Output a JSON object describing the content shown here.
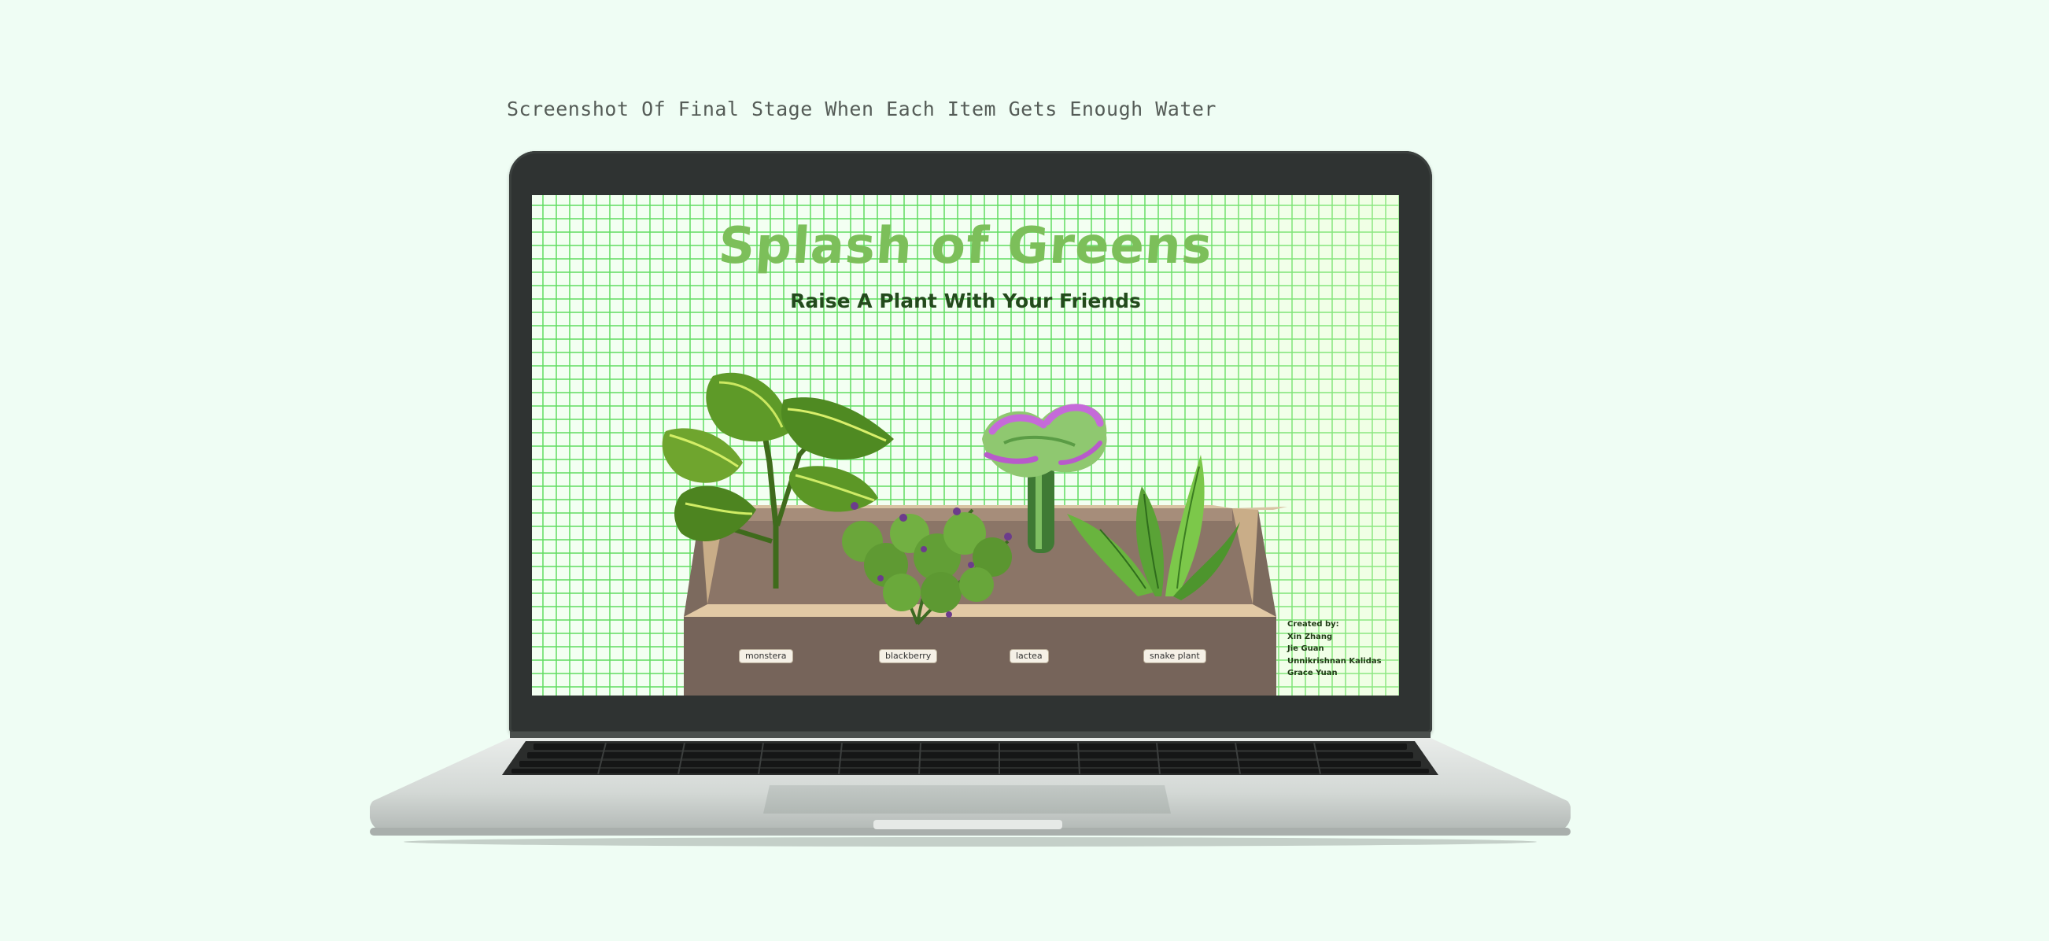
{
  "caption": "Screenshot Of Final Stage When Each Item Gets Enough Water",
  "app": {
    "title": "Splash of Greens",
    "subtitle": "Raise A Plant With Your Friends",
    "plant_tags": [
      "monstera",
      "blackberry",
      "lactea",
      "snake plant"
    ],
    "credits": {
      "heading": "Created by:",
      "names": [
        "Xin Zhang",
        "Jie Guan",
        "Unnikrishnan Kalidas",
        "Grace Yuan"
      ]
    }
  },
  "colors": {
    "page_background": "#effdf4",
    "grid_line": "#60dc60",
    "title_green": "#7cbf5a",
    "subtitle_dark_green": "#234a1c",
    "planter_brown": "#76645a"
  }
}
